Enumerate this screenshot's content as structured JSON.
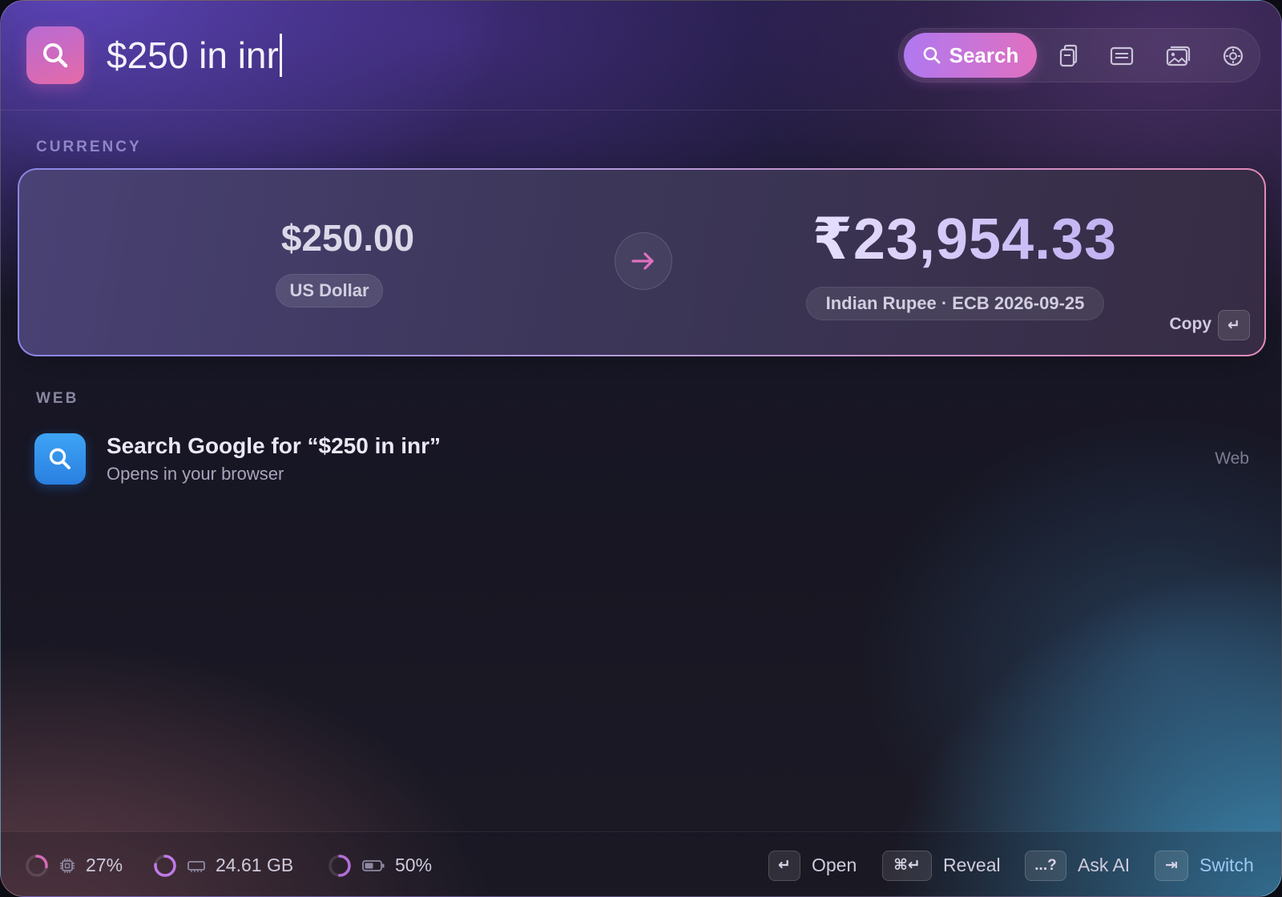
{
  "search": {
    "query": "$250 in inr",
    "button_label": "Search"
  },
  "toolbar": {
    "icons": [
      "clipboard-icon",
      "notes-icon",
      "images-icon",
      "settings-icon"
    ]
  },
  "sections": {
    "currency_label": "CURRENCY",
    "web_label": "WEB"
  },
  "conversion": {
    "from_amount": "$250.00",
    "from_currency": "US Dollar",
    "to_amount": "₹23,954.33",
    "to_details": "Indian Rupee · ECB 2026-09-25",
    "copy_label": "Copy",
    "copy_key": "↵"
  },
  "web_result": {
    "title": "Search Google for “$250 in inr”",
    "subtitle": "Opens in your browser",
    "tag": "Web"
  },
  "status": {
    "cpu": {
      "value": "27%",
      "fraction": 0.27
    },
    "memory": {
      "value": "24.61 GB",
      "fraction": 0.77
    },
    "battery": {
      "value": "50%",
      "fraction": 0.5
    }
  },
  "actions": [
    {
      "key": "↵",
      "label": "Open"
    },
    {
      "key": "⌘↵",
      "label": "Reveal"
    },
    {
      "key": "...?",
      "label": "Ask AI"
    },
    {
      "key": "⇥",
      "label": "Switch"
    }
  ],
  "colors": {
    "accent_start": "#b078f0",
    "accent_end": "#e070c0",
    "arrow": "#e070c0",
    "google_blue": "#2a7fe0"
  }
}
